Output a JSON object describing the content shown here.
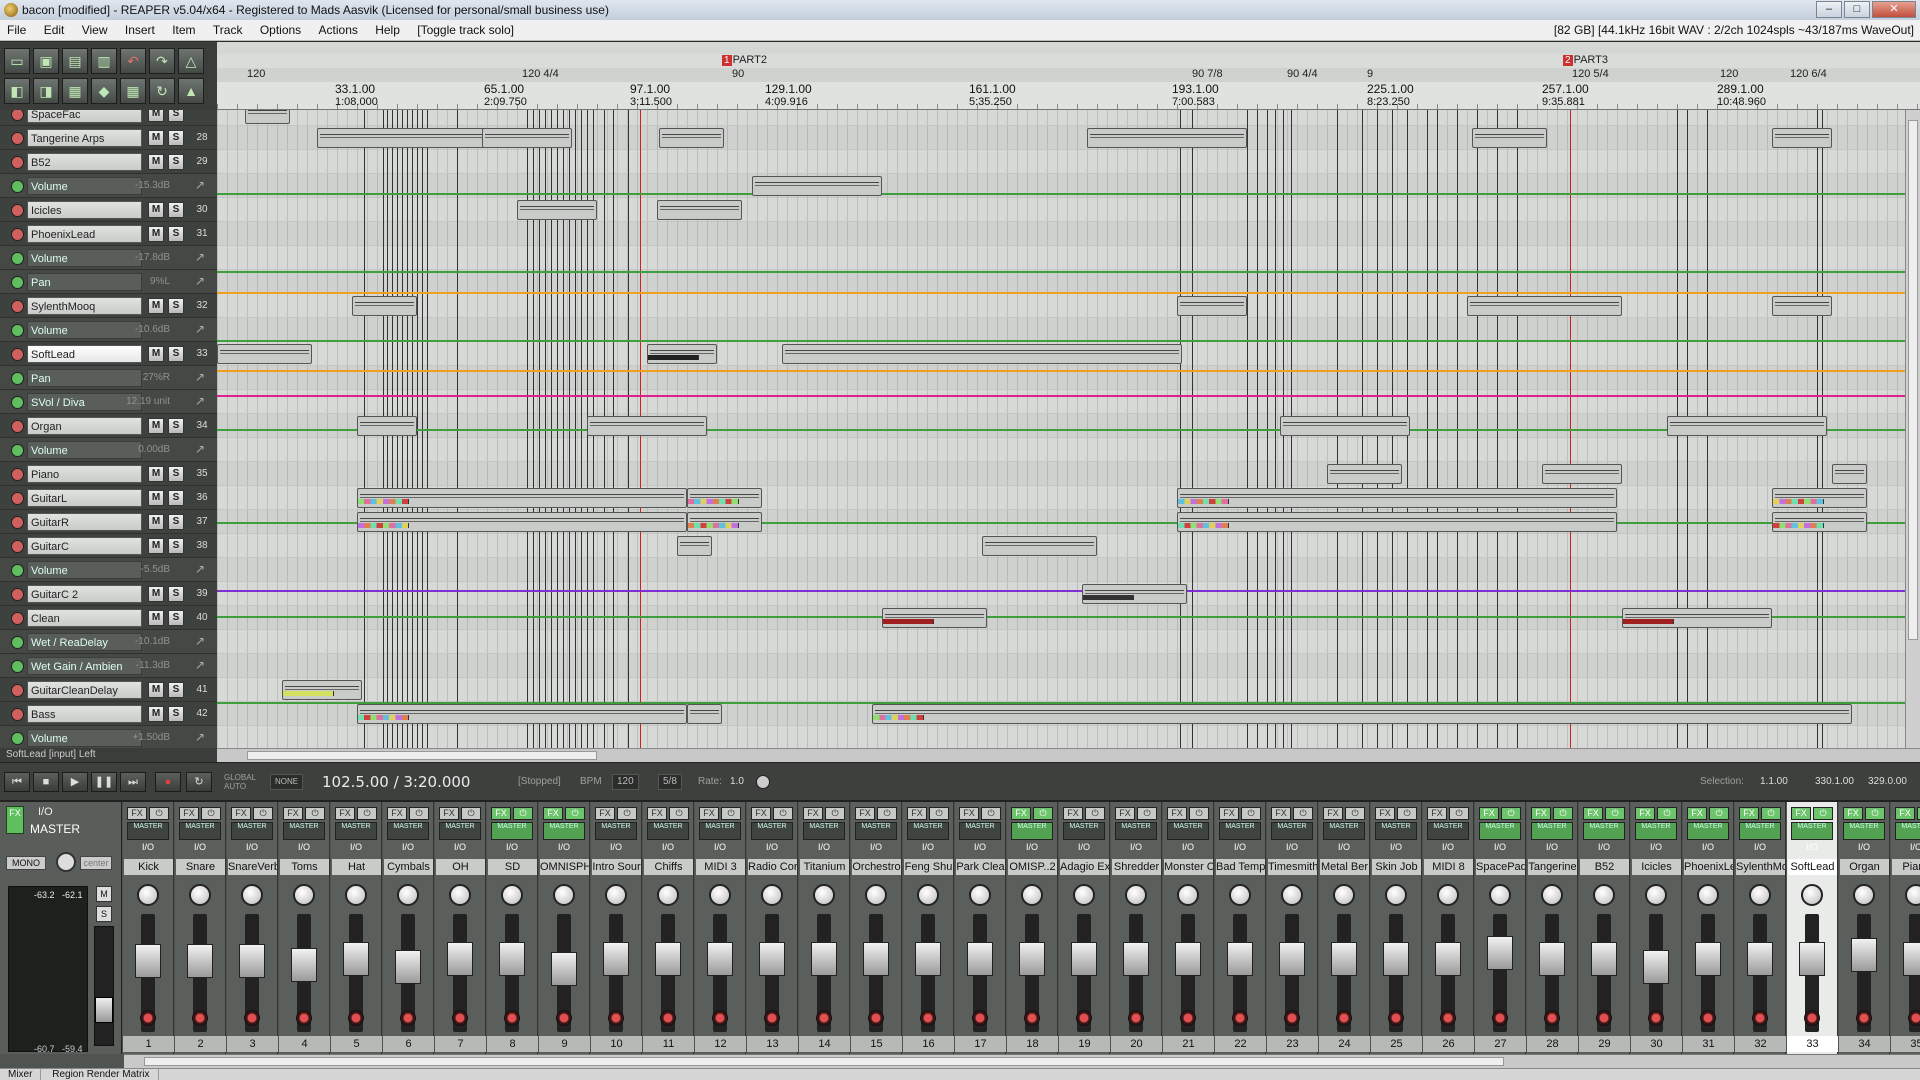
{
  "window": {
    "title": "bacon [modified] - REAPER v5.04/x64 - Registered to Mads Aasvik (Licensed for personal/small business use)",
    "buttons": [
      "–",
      "□",
      "✕"
    ]
  },
  "menu": {
    "items": [
      "File",
      "Edit",
      "View",
      "Insert",
      "Item",
      "Track",
      "Options",
      "Actions",
      "Help",
      "[Toggle track solo]"
    ],
    "status": "[82 GB] [44.1kHz 16bit WAV : 2/2ch 1024spls ~43/187ms WaveOut]"
  },
  "ruler": {
    "regions": [
      {
        "num": "1",
        "name": "PART2"
      },
      {
        "num": "2",
        "name": "PART3"
      }
    ],
    "tempo_marks": [
      "120",
      "120 4/4",
      "90",
      "90 7/8",
      "90 4/4",
      "9",
      "120 5/4",
      "120",
      "120 6/4"
    ],
    "bars": [
      {
        "bar": "33.1.00",
        "time": "1:08.000"
      },
      {
        "bar": "65.1.00",
        "time": "2:09.750"
      },
      {
        "bar": "97.1.00",
        "time": "3:11.500"
      },
      {
        "bar": "129.1.00",
        "time": "4:09.916"
      },
      {
        "bar": "161.1.00",
        "time": "5:35.250"
      },
      {
        "bar": "193.1.00",
        "time": "7:00.583"
      },
      {
        "bar": "225.1.00",
        "time": "8:23.250"
      },
      {
        "bar": "257.1.00",
        "time": "9:35.881"
      },
      {
        "bar": "289.1.00",
        "time": "10:48.960"
      }
    ]
  },
  "tracks": [
    {
      "name": "SpaceFac",
      "type": "track",
      "num": ""
    },
    {
      "name": "Tangerine Arps",
      "type": "track",
      "num": "28"
    },
    {
      "name": "B52",
      "type": "track",
      "num": "29"
    },
    {
      "name": "Volume",
      "type": "env",
      "value": "-15.3dB"
    },
    {
      "name": "Icicles",
      "type": "track",
      "num": "30"
    },
    {
      "name": "PhoenixLead",
      "type": "track",
      "num": "31"
    },
    {
      "name": "Volume",
      "type": "env",
      "value": "-17.8dB"
    },
    {
      "name": "Pan",
      "type": "env",
      "value": "9%L"
    },
    {
      "name": "SylenthMooq",
      "type": "track",
      "num": "32"
    },
    {
      "name": "Volume",
      "type": "env",
      "value": "-10.6dB"
    },
    {
      "name": "SoftLead",
      "type": "track",
      "num": "33",
      "selected": true
    },
    {
      "name": "Pan",
      "type": "env",
      "value": "27%R"
    },
    {
      "name": "SVol / Diva",
      "type": "env",
      "value": "12.19 unit"
    },
    {
      "name": "Organ",
      "type": "track",
      "num": "34"
    },
    {
      "name": "Volume",
      "type": "env",
      "value": "0.00dB"
    },
    {
      "name": "Piano",
      "type": "track",
      "num": "35"
    },
    {
      "name": "GuitarL",
      "type": "track",
      "num": "36"
    },
    {
      "name": "GuitarR",
      "type": "track",
      "num": "37"
    },
    {
      "name": "GuitarC",
      "type": "track",
      "num": "38"
    },
    {
      "name": "Volume",
      "type": "env",
      "value": "-5.5dB"
    },
    {
      "name": "GuitarC 2",
      "type": "track",
      "num": "39"
    },
    {
      "name": "Clean",
      "type": "track",
      "num": "40"
    },
    {
      "name": "Wet / ReaDelay",
      "type": "env",
      "value": "-10.1dB"
    },
    {
      "name": "Wet Gain / Ambien",
      "type": "env",
      "value": "-11.3dB"
    },
    {
      "name": "GuitarCleanDelay",
      "type": "track",
      "num": "41"
    },
    {
      "name": "Bass",
      "type": "track",
      "num": "42"
    },
    {
      "name": "Volume",
      "type": "env",
      "value": "+1.50dB"
    }
  ],
  "track_buttons": {
    "mute": "M",
    "solo": "S"
  },
  "status_line": "SoftLead [input] Left",
  "transport": {
    "position": "102.5.00 / 3:20.000",
    "state": "[Stopped]",
    "bpm_label": "BPM",
    "bpm": "120",
    "timesig": "5/8",
    "rate_label": "Rate:",
    "rate": "1.0",
    "global_auto": "GLOBAL AUTO",
    "none": "NONE",
    "selection_label": "Selection:",
    "selection_start": "1.1.00",
    "selection_end": "330.1.00",
    "selection_length": "329.0.00"
  },
  "mixer": {
    "master": {
      "name": "MASTER",
      "io": "I/O",
      "fx": "FX",
      "mono": "MONO",
      "center": "center",
      "peak_l": "-63.2",
      "peak_r": "-62.1",
      "bottom_l": "-60.7",
      "bottom_r": "-59.4",
      "buttons": [
        "M",
        "S"
      ]
    },
    "strips": [
      {
        "name": "Kick",
        "num": "1"
      },
      {
        "name": "Snare",
        "num": "2"
      },
      {
        "name": "SnareVerb",
        "num": "3"
      },
      {
        "name": "Toms",
        "num": "4"
      },
      {
        "name": "Hat",
        "num": "5"
      },
      {
        "name": "Cymbals",
        "num": "6"
      },
      {
        "name": "OH",
        "num": "7"
      },
      {
        "name": "SD",
        "num": "8"
      },
      {
        "name": "OMNISPH",
        "num": "9"
      },
      {
        "name": "Intro Sour",
        "num": "10"
      },
      {
        "name": "Chiffs",
        "num": "11"
      },
      {
        "name": "MIDI 3",
        "num": "12"
      },
      {
        "name": "Radio Cor",
        "num": "13"
      },
      {
        "name": "Titanium",
        "num": "14"
      },
      {
        "name": "Orchestro",
        "num": "15"
      },
      {
        "name": "Feng Shu",
        "num": "16"
      },
      {
        "name": "Park Clea",
        "num": "17"
      },
      {
        "name": "OMISP..2",
        "num": "18"
      },
      {
        "name": "Adagio Ex",
        "num": "19"
      },
      {
        "name": "Shredder",
        "num": "20"
      },
      {
        "name": "Monster C",
        "num": "21"
      },
      {
        "name": "Bad Temp",
        "num": "22"
      },
      {
        "name": "Timesmith",
        "num": "23"
      },
      {
        "name": "Metal Ber",
        "num": "24"
      },
      {
        "name": "Skin Job",
        "num": "25"
      },
      {
        "name": "MIDI 8",
        "num": "26"
      },
      {
        "name": "SpacePad",
        "num": "27"
      },
      {
        "name": "Tangerine",
        "num": "28"
      },
      {
        "name": "B52",
        "num": "29"
      },
      {
        "name": "Icicles",
        "num": "30"
      },
      {
        "name": "PhoenixLe",
        "num": "31"
      },
      {
        "name": "SylenthMo",
        "num": "32"
      },
      {
        "name": "SoftLead",
        "num": "33",
        "selected": true
      },
      {
        "name": "Organ",
        "num": "34"
      },
      {
        "name": "Piano",
        "num": "35"
      }
    ],
    "fx_label": "FX",
    "io_label": "I/O",
    "master_send_label": "MASTER"
  },
  "dock": {
    "tabs": [
      "Mixer",
      "Region Render Matrix"
    ]
  },
  "colors": {
    "accent_green": "#5fbf5f",
    "env_green": "#3f9f3f",
    "env_orange": "#f0a020",
    "env_pink": "#e0208f",
    "env_purple": "#8030d0",
    "marker_red": "#cc2020"
  }
}
